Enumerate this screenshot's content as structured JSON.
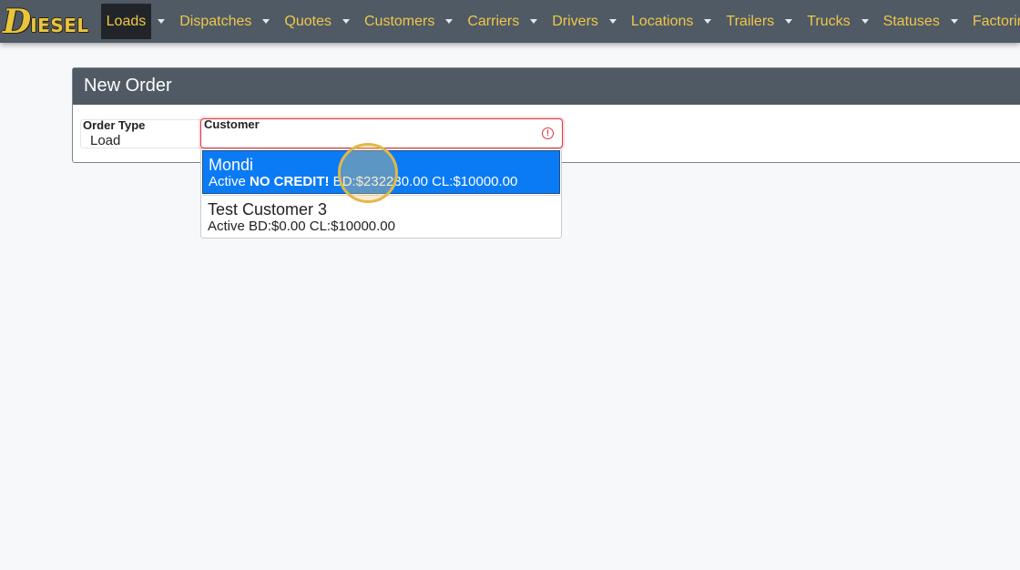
{
  "brand": {
    "letter": "D",
    "rest": "IESEL"
  },
  "nav": [
    {
      "label": "Loads",
      "active": true
    },
    {
      "label": "Dispatches"
    },
    {
      "label": "Quotes"
    },
    {
      "label": "Customers"
    },
    {
      "label": "Carriers"
    },
    {
      "label": "Drivers"
    },
    {
      "label": "Locations"
    },
    {
      "label": "Trailers"
    },
    {
      "label": "Trucks"
    },
    {
      "label": "Statuses"
    },
    {
      "label": "Factoring"
    }
  ],
  "form": {
    "title": "New Order",
    "order_type_label": "Order Type",
    "order_type_value": "Load",
    "customer_label": "Customer",
    "customer_value": "",
    "error_icon_glyph": "!"
  },
  "dropdown": {
    "options": [
      {
        "name": "Mondi",
        "status": "Active ",
        "flag": "NO CREDIT!",
        "balance": " BD:$232230.00 CL:$10000.00",
        "selected": true
      },
      {
        "name": "Test Customer 3",
        "status": "Active",
        "balance": " BD:$0.00 CL:$10000.00",
        "selected": false
      }
    ]
  },
  "colors": {
    "navbar": "#4f5a65",
    "nav_text": "#f0c74a",
    "brand": "#e9c53f",
    "selected_option": "#0b7bf5",
    "error": "#dc3545",
    "cursor_highlight": "#e0b84a"
  }
}
